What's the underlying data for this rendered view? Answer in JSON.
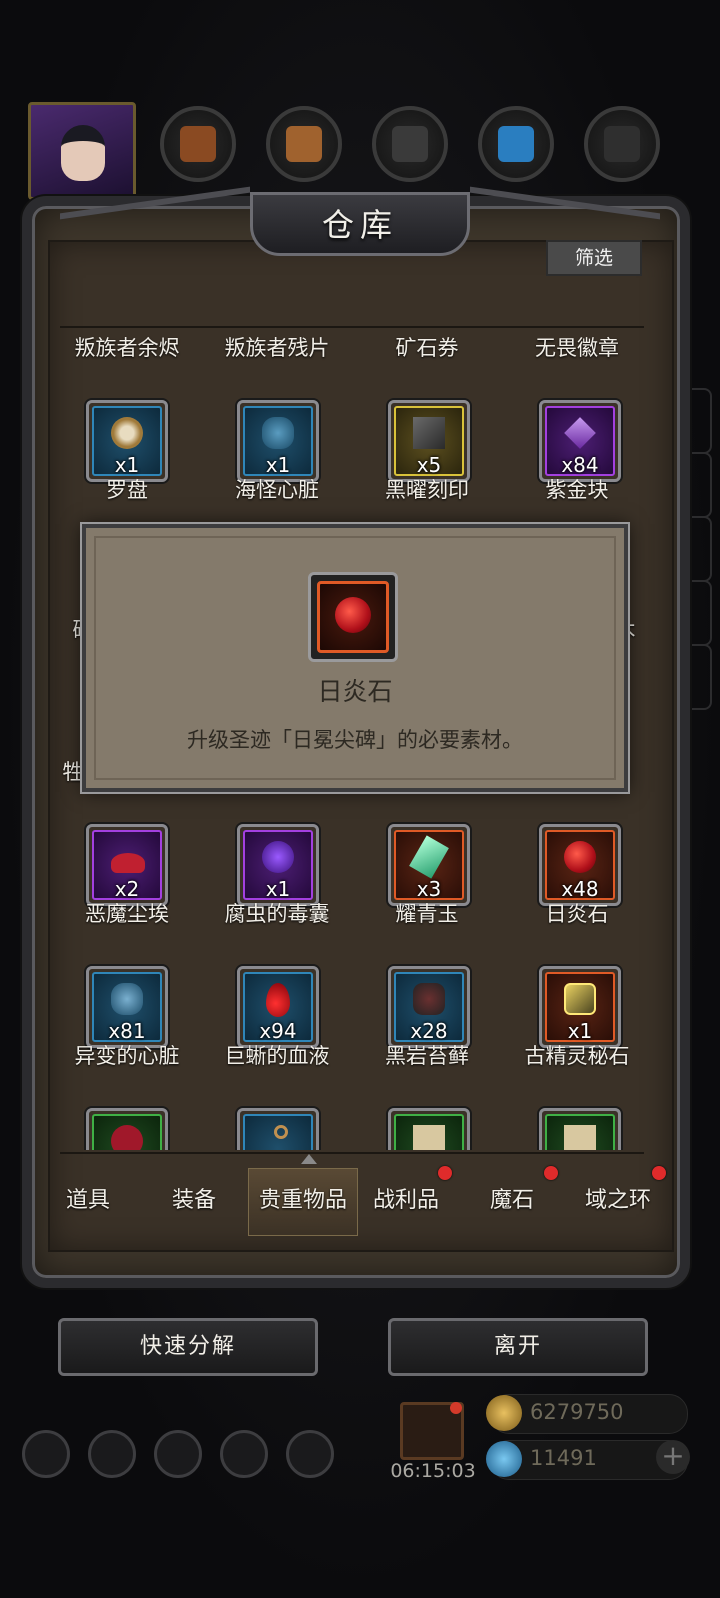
{
  "window": {
    "title": "仓库",
    "filter_label": "筛选"
  },
  "hud": {
    "resources": [
      "wood-log-icon",
      "plank-icon",
      "iron-ingot-icon",
      "crystal-icon",
      "ore-icon"
    ],
    "gold": "6279750",
    "gems": "11491",
    "timer": "06:15:03"
  },
  "category_row": [
    "叛族者余烬",
    "叛族者残片",
    "矿石券",
    "无畏徽章"
  ],
  "items_row1": [
    {
      "name": "罗盘",
      "qty": "x1",
      "rarity": "blue",
      "icon": "compass-icon"
    },
    {
      "name": "海怪心脏",
      "qty": "x1",
      "rarity": "blue",
      "icon": "sea-monster-heart-icon"
    },
    {
      "name": "黑曜刻印",
      "qty": "x5",
      "rarity": "gold",
      "icon": "obsidian-seal-icon"
    },
    {
      "name": "紫金块",
      "qty": "x84",
      "rarity": "purple",
      "icon": "purple-crystal-icon"
    }
  ],
  "items_row3": [
    {
      "name": "恶魔尘埃",
      "qty": "x2",
      "rarity": "purple",
      "icon": "demon-dust-icon"
    },
    {
      "name": "腐虫的毒囊",
      "qty": "x1",
      "rarity": "purple",
      "icon": "poison-sac-icon"
    },
    {
      "name": "耀青玉",
      "qty": "x3",
      "rarity": "orange",
      "icon": "jade-crystal-icon"
    },
    {
      "name": "日炎石",
      "qty": "x48",
      "rarity": "orange",
      "icon": "sunflame-stone-icon"
    }
  ],
  "items_row4": [
    {
      "name": "异变的心脏",
      "qty": "x81",
      "rarity": "blue",
      "icon": "mutated-heart-icon"
    },
    {
      "name": "巨蜥的血液",
      "qty": "x94",
      "rarity": "blue",
      "icon": "blood-drop-icon"
    },
    {
      "name": "黑岩苔藓",
      "qty": "x28",
      "rarity": "blue",
      "icon": "black-moss-icon"
    },
    {
      "name": "古精灵秘石",
      "qty": "x1",
      "rarity": "orange",
      "icon": "elf-stone-icon"
    }
  ],
  "items_row5": [
    {
      "rarity": "green",
      "icon": "red-spike-icon"
    },
    {
      "rarity": "blue",
      "icon": "key-icon"
    },
    {
      "rarity": "green",
      "icon": "scroll-icon"
    },
    {
      "rarity": "green",
      "icon": "scroll-icon"
    }
  ],
  "popup": {
    "name": "日炎石",
    "desc": "升级圣迹「日冕尖碑」的必要素材。",
    "left_peek": "砰",
    "right_peek": "木",
    "left_peek2": "牲"
  },
  "tabs": [
    {
      "label": "道具",
      "badge": false
    },
    {
      "label": "装备",
      "badge": false
    },
    {
      "label": "贵重物品",
      "badge": false,
      "active": true
    },
    {
      "label": "战利品",
      "badge": true
    },
    {
      "label": "魔石",
      "badge": true
    },
    {
      "label": "域之环",
      "badge": true
    }
  ],
  "buttons": {
    "decompose": "快速分解",
    "leave": "离开"
  },
  "colors": {
    "badge": "#e02b2b",
    "panel": "#3e362b",
    "popup": "#847a6b"
  }
}
